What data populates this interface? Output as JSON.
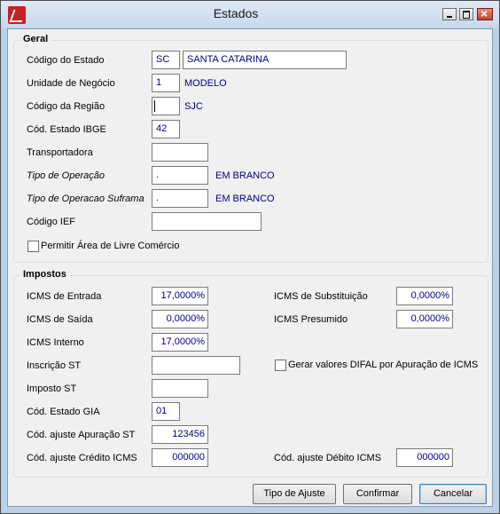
{
  "window": {
    "title": "Estados"
  },
  "geral": {
    "title": "Geral",
    "codigo_estado": {
      "label": "Código do Estado",
      "value": "SC",
      "desc": "SANTA CATARINA"
    },
    "unidade_negocio": {
      "label": "Unidade de Negócio",
      "value": "1",
      "desc": "MODELO"
    },
    "codigo_regiao": {
      "label": "Código da Região",
      "value": "",
      "desc": "SJC"
    },
    "cod_estado_ibge": {
      "label": "Cód. Estado IBGE",
      "value": "42"
    },
    "transportadora": {
      "label": "Transportadora",
      "value": ""
    },
    "tipo_operacao": {
      "label": "Tipo de Operação",
      "value": ".",
      "desc": "EM BRANCO"
    },
    "tipo_operacao_suframa": {
      "label": "Tipo de Operacao Suframa",
      "value": ".",
      "desc": "EM BRANCO"
    },
    "codigo_ief": {
      "label": "Código IEF",
      "value": ""
    },
    "livre_comercio": {
      "label": "Permitir Área de Livre Comércio",
      "checked": false
    }
  },
  "impostos": {
    "title": "Impostos",
    "icms_entrada": {
      "label": "ICMS de Entrada",
      "value": "17,0000%"
    },
    "icms_saida": {
      "label": "ICMS de Saída",
      "value": "0,0000%"
    },
    "icms_interno": {
      "label": "ICMS Interno",
      "value": "17,0000%"
    },
    "inscricao_st": {
      "label": "Inscrição ST",
      "value": ""
    },
    "imposto_st": {
      "label": "Imposto ST",
      "value": ""
    },
    "cod_estado_gia": {
      "label": "Cód. Estado GIA",
      "value": "01"
    },
    "cod_ajuste_apuracao_st": {
      "label": "Cód. ajuste Apuração ST",
      "value": "123456"
    },
    "cod_ajuste_credito_icms": {
      "label": "Cód. ajuste Crédito ICMS",
      "value": "000000"
    },
    "icms_substituicao": {
      "label": "ICMS de Substituição",
      "value": "0,0000%"
    },
    "icms_presumido": {
      "label": "ICMS Presumido",
      "value": "0,0000%"
    },
    "gerar_difal": {
      "label": "Gerar valores DIFAL por Apuração de ICMS",
      "checked": false
    },
    "cod_ajuste_debito_icms": {
      "label": "Cód. ajuste Débito ICMS",
      "value": "000000"
    }
  },
  "buttons": {
    "tipo_ajuste": "Tipo de Ajuste",
    "confirmar": "Confirmar",
    "cancelar": "Cancelar"
  }
}
